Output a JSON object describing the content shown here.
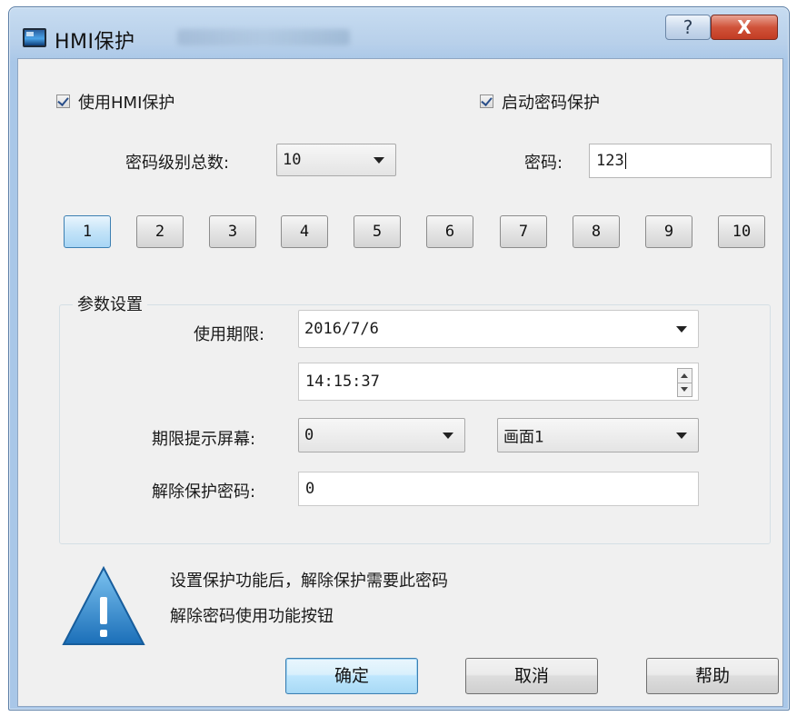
{
  "window": {
    "title": "HMI保护",
    "help_symbol": "?",
    "close_symbol": "X"
  },
  "options": {
    "use_hmi_protection": {
      "label": "使用HMI保护",
      "checked": true
    },
    "enable_password_protection": {
      "label": "启动密码保护",
      "checked": true
    }
  },
  "password_levels": {
    "label": "密码级别总数:",
    "value": "10"
  },
  "password": {
    "label": "密码:",
    "value": "123"
  },
  "level_buttons": [
    "1",
    "2",
    "3",
    "4",
    "5",
    "6",
    "7",
    "8",
    "9",
    "10"
  ],
  "active_level": "1",
  "params": {
    "group_title": "参数设置",
    "expiry_label": "使用期限:",
    "expiry_date": "2016/7/6",
    "expiry_time": "14:15:37",
    "prompt_label": "期限提示屏幕:",
    "prompt_value": "0",
    "screen_value": "画面1",
    "unlock_label": "解除保护密码:",
    "unlock_value": "0"
  },
  "notice": {
    "line1": "设置保护功能后，解除保护需要此密码",
    "line2": "解除密码使用功能按钮"
  },
  "buttons": {
    "ok": "确定",
    "cancel": "取消",
    "help": "帮助"
  },
  "colors": {
    "title_bar": "#b8d0ea",
    "close_button": "#c23c23",
    "warning": "#2b8ad0",
    "active_button": "#a8d6f5"
  }
}
